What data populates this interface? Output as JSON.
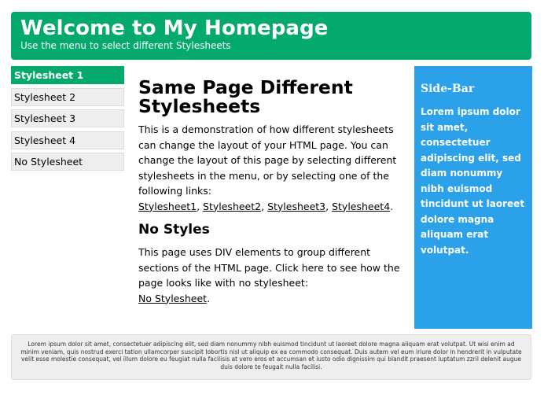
{
  "header": {
    "title": "Welcome to My Homepage",
    "subtitle": "Use the menu to select different Stylesheets"
  },
  "menu": {
    "items": [
      {
        "label": "Stylesheet 1",
        "active": true
      },
      {
        "label": "Stylesheet 2",
        "active": false
      },
      {
        "label": "Stylesheet 3",
        "active": false
      },
      {
        "label": "Stylesheet 4",
        "active": false
      },
      {
        "label": "No Stylesheet",
        "active": false
      }
    ]
  },
  "main": {
    "heading": "Same Page Different Stylesheets",
    "intro": "This is a demonstration of how different stylesheets can change the layout of your HTML page. You can change the layout of this page by selecting different stylesheets in the menu, or by selecting one of the following links:",
    "links": [
      "Stylesheet1",
      "Stylesheet2",
      "Stylesheet3",
      "Stylesheet4"
    ],
    "link_separator": ", ",
    "links_end": ".",
    "section_heading": "No Styles",
    "section_text": "This page uses DIV elements to group different sections of the HTML page. Click here to see how the page looks like with no stylesheet:",
    "section_link": "No Stylesheet",
    "section_link_end": "."
  },
  "sidebar": {
    "title": "Side-Bar",
    "text": "Lorem ipsum dolor sit amet, consectetuer adipiscing elit, sed diam nonummy nibh euismod tincidunt ut laoreet dolore magna aliquam erat volutpat."
  },
  "footer": {
    "text": "Lorem ipsum dolor sit amet, consectetuer adipiscing elit, sed diam nonummy nibh euismod tincidunt ut laoreet dolore magna aliquam erat volutpat. Ut wisi enim ad minim veniam, quis nostrud exerci tation ullamcorper suscipit lobortis nisl ut aliquip ex ea commodo consequat. Duis autem vel eum iriure dolor in hendrerit in vulputate velit esse molestie consequat, vel illum dolore eu feugiat nulla facilisis at vero eros et accumsan et iusto odio dignissim qui blandit praesent luptatum zzril delenit augue duis dolore te feugait nulla facilisi."
  },
  "colors": {
    "header_bg": "#04AA6D",
    "active_menu_bg": "#04AA6D",
    "menu_bg": "#EEEEEE",
    "sidebar_bg": "#2AA1E8",
    "footer_bg": "#EEEEEE"
  }
}
